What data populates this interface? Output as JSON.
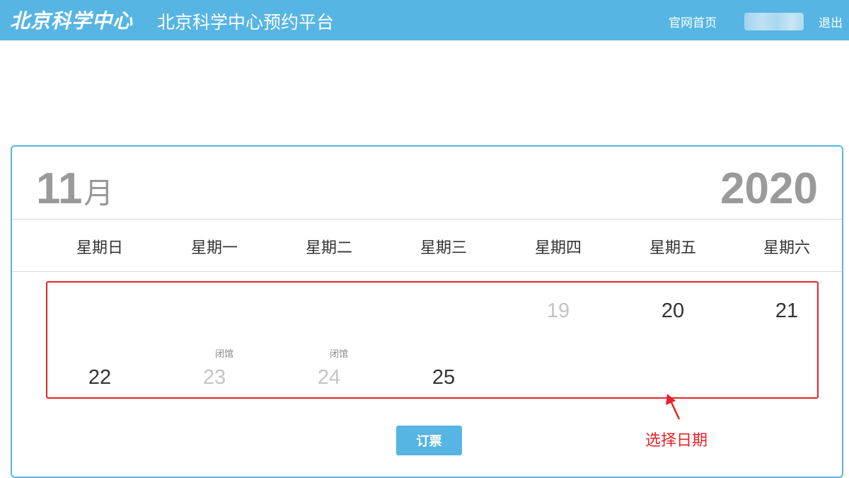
{
  "header": {
    "logo_text": "北京科学中心",
    "platform_title": "北京科学中心预约平台",
    "nav_home": "官网首页",
    "nav_logout": "退出"
  },
  "calendar": {
    "month_number": "11",
    "month_suffix": "月",
    "year": "2020",
    "weekdays": [
      "星期日",
      "星期一",
      "星期二",
      "星期三",
      "星期四",
      "星期五",
      "星期六"
    ],
    "week1": [
      {
        "day": "19",
        "status": "disabled"
      },
      {
        "day": "20",
        "status": "available"
      },
      {
        "day": "21",
        "status": "available"
      }
    ],
    "week2": [
      {
        "day": "22",
        "status": "available"
      },
      {
        "day": "23",
        "status": "closed",
        "note": "闭馆"
      },
      {
        "day": "24",
        "status": "closed",
        "note": "闭馆"
      },
      {
        "day": "25",
        "status": "available"
      }
    ],
    "book_button": "订票"
  },
  "annotation": {
    "text": "选择日期",
    "color": "#e8222a"
  },
  "colors": {
    "brand": "#56b5e3",
    "annotation_red": "#e8222a",
    "disabled_day": "#c4c4c4",
    "muted_header": "#9a9a9a"
  }
}
